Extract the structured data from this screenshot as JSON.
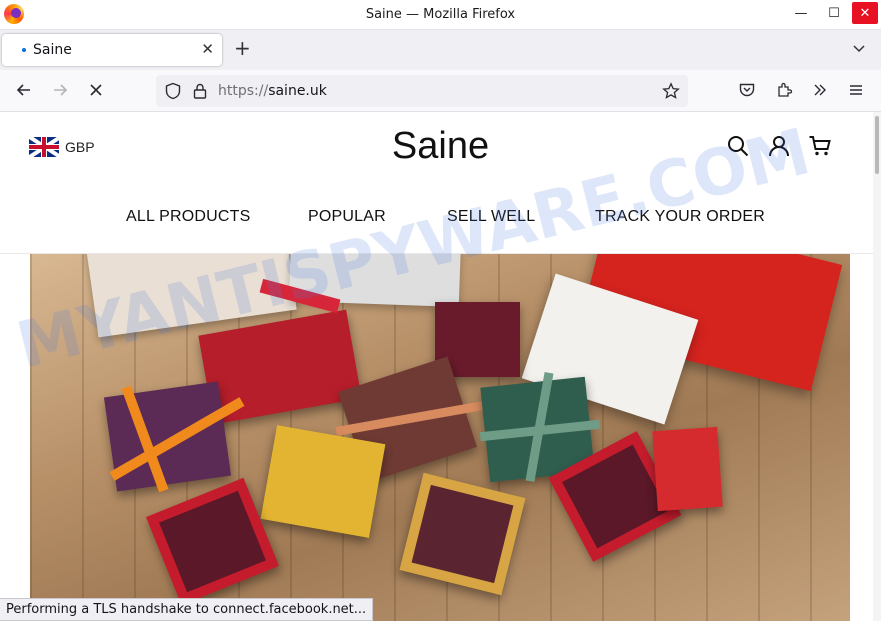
{
  "window": {
    "title": "Saine — Mozilla Firefox",
    "min_glyph": "—",
    "max_glyph": "☐",
    "close_glyph": "✕"
  },
  "tabs": [
    {
      "label": "Saine",
      "close_glyph": "✕",
      "loading": true
    }
  ],
  "tabstrip": {
    "new_tab_glyph": "+",
    "list_glyph": "⌄"
  },
  "navbar": {
    "url_scheme": "https://",
    "url_host": "saine.uk",
    "back_glyph": "←",
    "forward_glyph": "→",
    "stop_glyph": "✕",
    "overflow_glyph": "»",
    "menu_glyph": "≡"
  },
  "site": {
    "currency": "GBP",
    "logo": "Saine",
    "menu": [
      "ALL PRODUCTS",
      "POPULAR",
      "SELL WELL",
      "TRACK YOUR ORDER"
    ]
  },
  "watermark": "MYANTISPYWARE.COM",
  "status": "Performing a TLS handshake to connect.facebook.net...",
  "colors": {
    "accent_dot": "#0b72d9",
    "close_button": "#e81123",
    "bag_red": "#d5231e"
  }
}
